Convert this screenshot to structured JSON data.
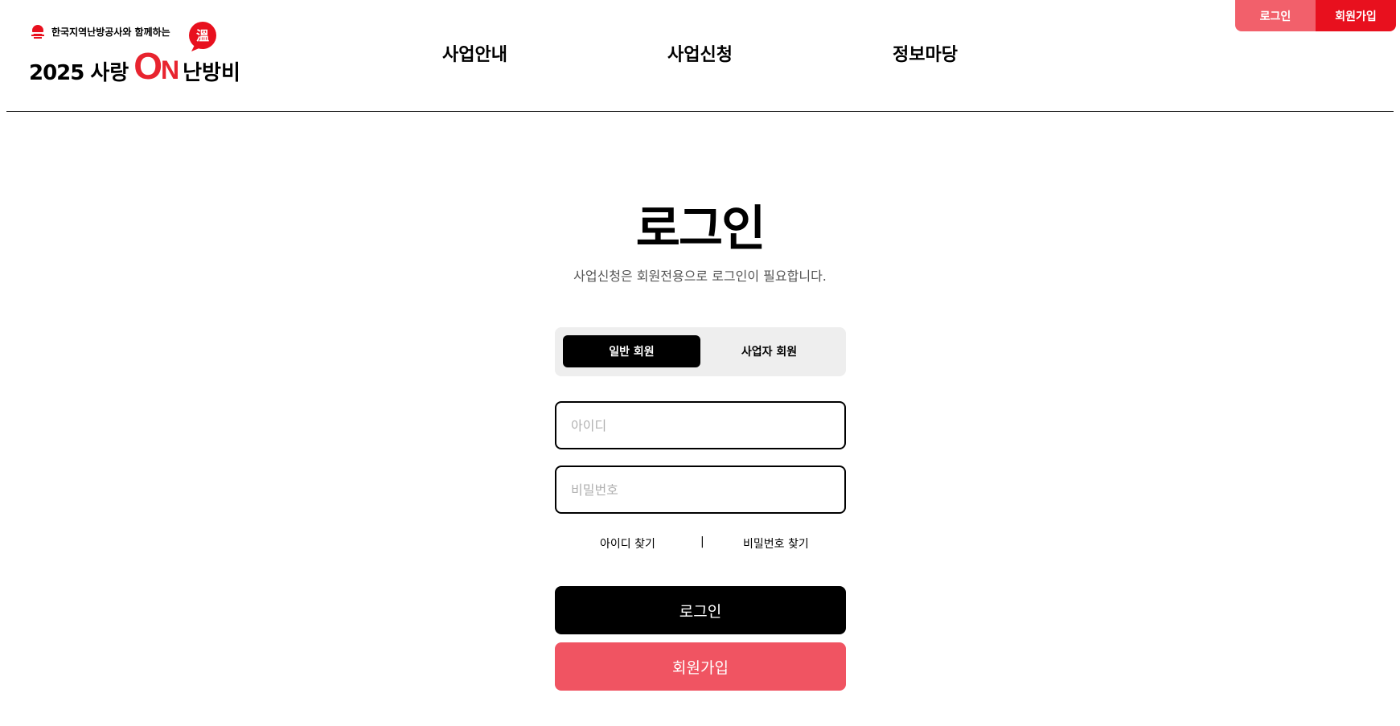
{
  "header": {
    "logo": {
      "tagline": "한국지역난방공사와 함께하는",
      "year": "2025",
      "love": "사랑",
      "on_o": "O",
      "on_n": "N",
      "heat": "난방비",
      "bubble_char": "溫"
    },
    "nav": [
      "사업안내",
      "사업신청",
      "정보마당"
    ],
    "auth": {
      "login": "로그인",
      "signup": "회원가입"
    }
  },
  "main": {
    "title": "로그인",
    "subtitle": "사업신청은 회원전용으로 로그인이 필요합니다.",
    "member_tabs": {
      "general": "일반 회원",
      "business": "사업자 회원",
      "selected": "일반 회원"
    },
    "id_field": {
      "placeholder": "아이디",
      "value": ""
    },
    "pw_field": {
      "placeholder": "비밀번호",
      "value": ""
    },
    "find": {
      "id": "아이디 찾기",
      "separator": "|",
      "pw": "비밀번호 찾기"
    },
    "login_button": "로그인",
    "signup_button": "회원가입"
  },
  "colors": {
    "brand_red": "#e8101e",
    "light_red": "#f2606b",
    "signup_button": "#f05462",
    "dark": "#000000"
  }
}
